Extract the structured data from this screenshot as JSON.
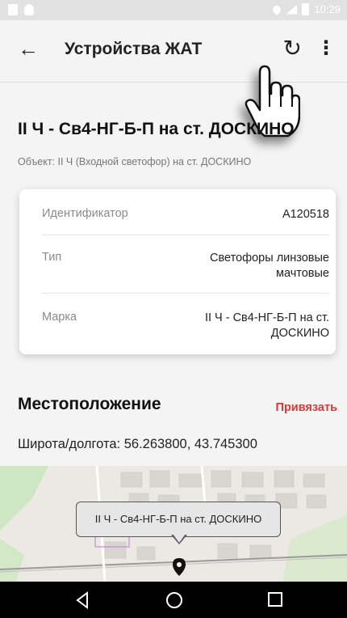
{
  "status_bar": {
    "time": "10:29",
    "icons": [
      "notification-icon",
      "android-icon",
      "location-icon",
      "signal-icon",
      "battery-icon"
    ]
  },
  "app_bar": {
    "back_icon": "arrow-back-icon",
    "title": "Устройства ЖАТ",
    "refresh_icon": "refresh-icon",
    "menu_icon": "more-vert-icon"
  },
  "device": {
    "name": "II Ч - Св4-НГ-Б-П на ст. ДОСКИНО",
    "object": "Объект: II Ч (Входной светофор) на ст. ДОСКИНО"
  },
  "details": [
    {
      "label": "Идентификатор",
      "value": "А120518"
    },
    {
      "label": "Тип",
      "value": "Светофоры линзовые мачтовые"
    },
    {
      "label": "Марка",
      "value": "II Ч - Св4-НГ-Б-П на ст. ДОСКИНО"
    }
  ],
  "location": {
    "title": "Местоположение",
    "bind_label": "Привязать",
    "coords": "Широта/долгота: 56.263800, 43.745300"
  },
  "map": {
    "tooltip": "II Ч - Св4-НГ-Б-П на ст. ДОСКИНО",
    "marker_icon": "map-pin-icon"
  },
  "nav_bar": {
    "icons": [
      "nav-back-icon",
      "nav-home-icon",
      "nav-recents-icon"
    ]
  },
  "colors": {
    "accent": "#d33b3b",
    "background": "#f4f4f4",
    "card": "#ffffff"
  }
}
